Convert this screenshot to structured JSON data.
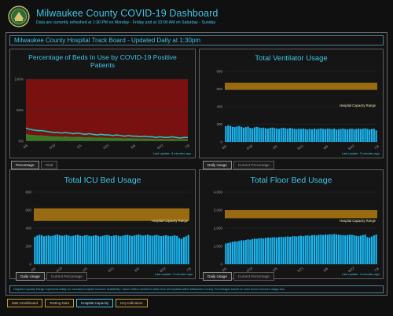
{
  "header": {
    "title": "Milwaukee County COVID-19 Dashboard",
    "subtitle": "Data are currently refreshed at 1:30 PM on Monday - Friday and at 10:00 AM on Saturday - Sunday"
  },
  "track_board": {
    "title": "Milwaukee County Hospital Track Board - Updated Daily at 1:30pm"
  },
  "colors": {
    "accent": "#3ec4e6",
    "bar": "#1ab5f0",
    "capacity_band": "#b07a10",
    "beds_red": "#7a1111",
    "beds_green": "#2f8b2c",
    "beds_line": "#18c7c0"
  },
  "panels": {
    "beds": {
      "title": "Percentage of Beds In Use by COVID-19 Positive Patients",
      "last_update": "Last update: 3 minutes ago",
      "tabs": [
        "Percentage",
        "Total"
      ],
      "active_tab": 0
    },
    "ventilator": {
      "title": "Total Ventilator Usage",
      "last_update": "Last update: 3 minutes ago",
      "tabs": [
        "Daily Usage",
        "Current Percentage"
      ],
      "active_tab": 0
    },
    "icu": {
      "title": "Total ICU Bed Usage",
      "last_update": "Last update: 3 minutes ago",
      "tabs": [
        "Daily Usage",
        "Current Percentage"
      ],
      "active_tab": 0
    },
    "floor": {
      "title": "Total Floor Bed Usage",
      "last_update": "Last update: 3 minutes ago",
      "tabs": [
        "Daily Usage",
        "Current Percentage"
      ],
      "active_tab": 0
    }
  },
  "footnote": "Hospital Capacity Range represents ability for increased hospital resource availability / values reflect combined totals from all hospitals within Milwaukee County. Percentages based on most recent resource usage and",
  "bottom_nav": {
    "items": [
      "Main Dashboard",
      "Testing Data",
      "Hospital Capacity",
      "Key Indicators"
    ],
    "active": 2
  },
  "chart_data": [
    {
      "type": "area",
      "title": "Percentage of Beds In Use by COVID-19 Positive Patients",
      "x_ticks": [
        "4/6",
        "4/19",
        "5/5",
        "5/21",
        "6/6",
        "6/22",
        "7/8"
      ],
      "y_ticks": [
        "0%",
        "50%",
        "100%"
      ],
      "ylim": [
        0,
        100
      ],
      "series": [
        {
          "values": [
            21,
            19,
            18,
            17,
            17,
            16,
            15,
            14,
            14,
            13,
            14,
            13,
            12,
            13,
            12,
            11,
            12,
            11,
            10,
            11,
            10,
            10,
            9,
            10,
            9,
            8,
            9,
            8,
            8,
            7,
            8,
            7,
            7,
            6,
            7,
            6,
            6,
            7,
            6,
            5,
            6,
            6
          ]
        }
      ]
    },
    {
      "type": "bar",
      "title": "Total Ventilator Usage",
      "annotation": "Hospital Capacity Range",
      "capacity_range": [
        590,
        670
      ],
      "x_ticks": [
        "4/6",
        "4/19",
        "5/5",
        "5/21",
        "6/6",
        "6/22",
        "7/8"
      ],
      "y_ticks": [
        "0",
        "200",
        "400",
        "600",
        "800"
      ],
      "ylim": [
        0,
        800
      ],
      "values": [
        178,
        186,
        182,
        172,
        168,
        176,
        180,
        171,
        162,
        168,
        174,
        160,
        155,
        166,
        171,
        164,
        158,
        162,
        155,
        152,
        160,
        163,
        158,
        152,
        149,
        157,
        161,
        154,
        150,
        158,
        153,
        149,
        146,
        150,
        148,
        152,
        147,
        142,
        148,
        144,
        151,
        145,
        150,
        154,
        149,
        146,
        152,
        150,
        147,
        151,
        140,
        145,
        148,
        152,
        146,
        143,
        149,
        151,
        145,
        148,
        152,
        147,
        150,
        155,
        149,
        142,
        148,
        150,
        131
      ]
    },
    {
      "type": "bar",
      "title": "Total ICU Bed Usage",
      "annotation": "Hospital Capacity Range",
      "capacity_range": [
        480,
        620
      ],
      "x_ticks": [
        "4/6",
        "4/19",
        "5/5",
        "5/21",
        "6/6",
        "6/22",
        "7/8"
      ],
      "y_ticks": [
        "0",
        "200",
        "400",
        "600",
        "800"
      ],
      "ylim": [
        0,
        800
      ],
      "values": [
        305,
        318,
        326,
        322,
        310,
        315,
        320,
        312,
        318,
        324,
        330,
        322,
        316,
        320,
        325,
        318,
        312,
        316,
        322,
        326,
        318,
        314,
        320,
        324,
        317,
        312,
        318,
        322,
        315,
        310,
        316,
        321,
        325,
        318,
        312,
        319,
        322,
        316,
        311,
        318,
        323,
        327,
        320,
        314,
        319,
        325,
        330,
        322,
        318,
        324,
        328,
        320,
        316,
        321,
        326,
        318,
        313,
        318,
        322,
        317,
        312,
        316,
        320,
        314,
        290,
        282,
        300,
        310,
        325
      ]
    },
    {
      "type": "bar",
      "title": "Total Floor Bed Usage",
      "annotation": "Hospital Capacity Range",
      "capacity_range": [
        2550,
        3000
      ],
      "x_ticks": [
        "4/6",
        "4/19",
        "5/5",
        "5/21",
        "6/6",
        "6/22",
        "7/8"
      ],
      "y_ticks": [
        "0",
        "1,000",
        "2,000",
        "3,000",
        "4,000"
      ],
      "ylim": [
        0,
        4000
      ],
      "values": [
        1150,
        1180,
        1210,
        1240,
        1270,
        1260,
        1300,
        1330,
        1320,
        1350,
        1380,
        1360,
        1400,
        1420,
        1410,
        1440,
        1450,
        1430,
        1460,
        1480,
        1470,
        1490,
        1500,
        1480,
        1510,
        1520,
        1500,
        1530,
        1540,
        1520,
        1550,
        1560,
        1540,
        1570,
        1580,
        1560,
        1590,
        1600,
        1580,
        1610,
        1620,
        1600,
        1630,
        1640,
        1620,
        1650,
        1640,
        1660,
        1650,
        1670,
        1660,
        1640,
        1620,
        1610,
        1600,
        1620,
        1640,
        1630,
        1610,
        1580,
        1560,
        1590,
        1620,
        1640,
        1500,
        1480,
        1540,
        1600,
        1650
      ]
    }
  ]
}
